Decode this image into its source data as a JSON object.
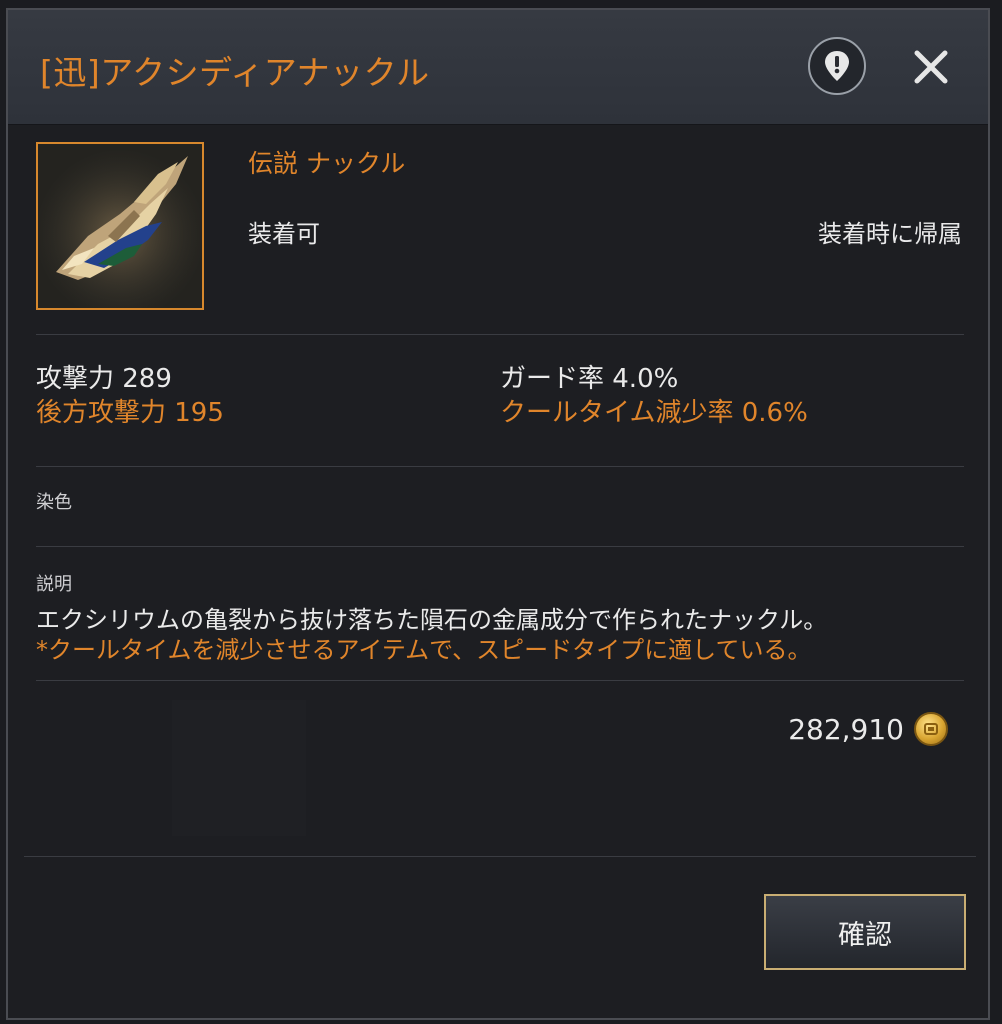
{
  "window": {
    "title": "[迅]アクシディアナックル",
    "hint_icon": "hint-pin-icon",
    "close_icon": "close-icon"
  },
  "item": {
    "image_icon": "knuckle-weapon-icon",
    "rarity_type": "伝説 ナックル",
    "equip_status": "装着可",
    "bind_status": "装着時に帰属"
  },
  "stats": {
    "attack": "攻撃力 289",
    "back_attack": "後方攻撃力 195",
    "guard_rate": "ガード率 4.0%",
    "cooldown_reduction": "クールタイム減少率 0.6%"
  },
  "dye": {
    "label": "染色"
  },
  "description": {
    "label": "説明",
    "line1": "エクシリウムの亀裂から抜け落ちた隕石の金属成分で作られたナックル。",
    "line2": "*クールタイムを減少させるアイテムで、スピードタイプに適している。"
  },
  "price": {
    "value": "282,910",
    "currency_icon": "gold-coin-icon"
  },
  "buttons": {
    "confirm": "確認"
  },
  "colors": {
    "accent_orange": "#e0852b",
    "frame_gold": "#c9ae73",
    "background": "#1d1e22"
  }
}
